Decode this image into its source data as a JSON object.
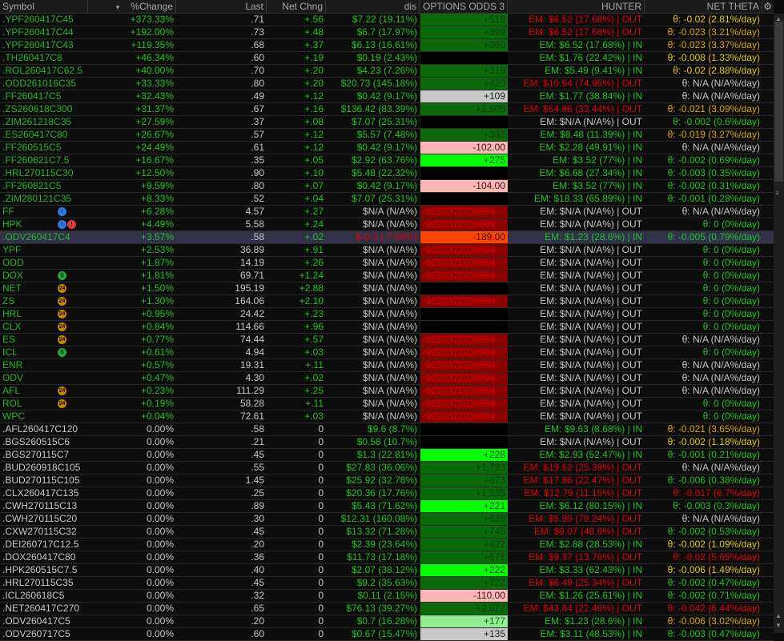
{
  "header": {
    "symbol": "Symbol",
    "sort_icon": "▾",
    "pct": "%Change",
    "last": "Last",
    "net": "Net Chng",
    "dis": "dis",
    "odds": "OPTIONS ODDS 3",
    "hunter": "HUNTER",
    "theta": "NET THETA"
  },
  "icons": {
    "b": {
      "glyph": "!",
      "bg": "#2a7be4"
    },
    "rd": {
      "glyph": "!",
      "bg": "#e03a3a"
    },
    "s": {
      "glyph": "S",
      "bg": "#1faa3a"
    },
    "e": {
      "glyph": "24",
      "bg": "#c8860a"
    }
  },
  "rows": [
    {
      "c": [
        ".YPF260417C45",
        "+373.33%",
        ".71",
        "+.56",
        "$7.22 (19.11%)",
        "+518",
        "EM: $6.52 (17.68%) | OUT",
        "θ: -0.02 (2.81%/day)"
      ],
      "s": "sg",
      "l": "w",
      "d": "g",
      "ob": "dg",
      "h": "r",
      "t": "y"
    },
    {
      "c": [
        ".YPF260417C44",
        "+192.00%",
        ".73",
        "+.48",
        "$6.7 (17.97%)",
        "+399",
        "EM: $6.52 (17.68%) | OUT",
        "θ: -0.023 (3.21%/day)"
      ],
      "s": "sg",
      "l": "w",
      "d": "g",
      "ob": "dg",
      "h": "r",
      "t": "o"
    },
    {
      "c": [
        ".YPF260417C43",
        "+119.35%",
        ".68",
        "+.37",
        "$6.13 (16.61%)",
        "+360",
        "EM: $6.52 (17.68%) | IN",
        "θ: -0.023 (3.37%/day)"
      ],
      "s": "sg",
      "l": "w",
      "d": "g",
      "ob": "dg",
      "h": "g",
      "t": "o"
    },
    {
      "c": [
        ".TH260417C8",
        "+46.34%",
        ".60",
        "+.19",
        "$0.19 (2.43%)",
        "",
        "EM: $1.76 (22.42%) | IN",
        "θ: -0.008 (1.33%/day)"
      ],
      "s": "sg",
      "l": "w",
      "d": "g",
      "ob": "bk",
      "h": "g",
      "t": "y"
    },
    {
      "c": [
        ".ROL260417C62.5",
        "+40.00%",
        ".70",
        "+.20",
        "$4.23 (7.26%)",
        "+318",
        "EM: $5.49 (9.41%) | IN",
        "θ: -0.02 (2.88%/day)"
      ],
      "s": "sg",
      "l": "w",
      "d": "g",
      "ob": "dg",
      "h": "g",
      "t": "y"
    },
    {
      "c": [
        ".ODD261016C35",
        "+33.33%",
        ".80",
        "+.20",
        "$20.73 (145.18%)",
        "+420",
        "EM: $10.64 (74.95%) | OUT",
        "θ: N/A (N/A%/day)"
      ],
      "s": "sg",
      "l": "w",
      "d": "g",
      "ob": "dg",
      "h": "r",
      "t": "w"
    },
    {
      "c": [
        ".FF260417C5",
        "+32.43%",
        ".49",
        "+.12",
        "$0.42 (9.17%)",
        "+109",
        "EM: $1.77 (38.84%) | IN",
        "θ: N/A (N/A%/day)"
      ],
      "s": "sg",
      "l": "w",
      "d": "g",
      "ob": "gray",
      "h": "g",
      "t": "w"
    },
    {
      "c": [
        ".ZS260618C300",
        "+31.37%",
        ".67",
        "+.16",
        "$136.42 (83.39%)",
        "+2,505",
        "EM: $54.86 (33.44%) | OUT",
        "θ: -0.021 (3.09%/day)"
      ],
      "s": "sg",
      "l": "w",
      "d": "g",
      "ob": "dg",
      "h": "r",
      "t": "o"
    },
    {
      "c": [
        ".ZIM261218C35",
        "+27.59%",
        ".37",
        "+.08",
        "$7.07 (25.31%)",
        "",
        "EM: $N/A (N/A%) | OUT",
        "θ: -0.002 (0.6%/day)"
      ],
      "s": "sg",
      "l": "w",
      "d": "g",
      "ob": "bk",
      "h": "w",
      "t": "g"
    },
    {
      "c": [
        ".ES260417C80",
        "+26.67%",
        ".57",
        "+.12",
        "$5.57 (7.48%)",
        "+382",
        "EM: $8.48 (11.39%) | IN",
        "θ: -0.019 (3.27%/day)"
      ],
      "s": "sg",
      "l": "w",
      "d": "g",
      "ob": "dg",
      "h": "g",
      "t": "o"
    },
    {
      "c": [
        ".FF260515C5",
        "+24.49%",
        ".61",
        "+.12",
        "$0.42 (9.17%)",
        "-102.00",
        "EM: $2.28 (49.91%) | IN",
        "θ: N/A (N/A%/day)"
      ],
      "s": "sg",
      "l": "w",
      "d": "g",
      "ob": "pink",
      "h": "g",
      "t": "w"
    },
    {
      "c": [
        ".FF260821C7.5",
        "+16.67%",
        ".35",
        "+.05",
        "$2.92 (63.76%)",
        "+275",
        "EM: $3.52 (77%) | IN",
        "θ: -0.002 (0.69%/day)"
      ],
      "s": "sg",
      "l": "w",
      "d": "g",
      "ob": "lime",
      "h": "g",
      "t": "g"
    },
    {
      "c": [
        ".HRL270115C30",
        "+12.50%",
        ".90",
        "+.10",
        "$5.48 (22.32%)",
        "",
        "EM: $6.68 (27.34%) | IN",
        "θ: -0.003 (0.35%/day)"
      ],
      "s": "sg",
      "l": "w",
      "d": "g",
      "ob": "bk",
      "h": "g",
      "t": "g"
    },
    {
      "c": [
        ".FF260821C5",
        "+9.59%",
        ".80",
        "+.07",
        "$0.42 (9.17%)",
        "-104.00",
        "EM: $3.52 (77%) | IN",
        "θ: -0.002 (0.31%/day)"
      ],
      "s": "sg",
      "l": "w",
      "d": "g",
      "ob": "pink",
      "h": "g",
      "t": "g"
    },
    {
      "c": [
        ".ZIM280121C35",
        "+8.33%",
        ".52",
        "+.04",
        "$7.07 (25.31%)",
        "",
        "EM: $18.33 (65.89%) | IN",
        "θ: -0.001 (0.28%/day)"
      ],
      "s": "sg",
      "l": "w",
      "d": "g",
      "ob": "bk",
      "h": "g",
      "t": "g"
    },
    {
      "c": [
        "FF",
        "+6.28%",
        "4.57",
        "+.27",
        "$N/A (N/A%)",
        "-92233720368547...",
        "EM: $N/A (N/A%) | OUT",
        "θ: N/A (N/A%/day)"
      ],
      "s": "sg",
      "l": "w",
      "d": "w",
      "ob": "dr",
      "h": "w",
      "t": "w",
      "i": [
        "b"
      ]
    },
    {
      "c": [
        "HPK",
        "+4.49%",
        "5.58",
        "+.24",
        "$N/A (N/A%)",
        "-92233720368547...",
        "EM: $N/A (N/A%) | OUT",
        "θ: 0 (0%/day)"
      ],
      "s": "sg",
      "l": "w",
      "d": "w",
      "ob": "dr",
      "h": "w",
      "t": "g",
      "i": [
        "b",
        "rd"
      ]
    },
    {
      "c": [
        ".ODV260417C4",
        "+3.57%",
        ".58",
        "+.02",
        "$-0.3 (-7.08%)",
        "-189.00",
        "EM: $1.23 (28.6%) | IN",
        "θ: -0.005 (0.79%/day)"
      ],
      "s": "sg",
      "l": "w",
      "d": "r",
      "ob": "or",
      "h": "g",
      "t": "g",
      "sel": true
    },
    {
      "c": [
        "YPF",
        "+2.53%",
        "36.89",
        "+.91",
        "$N/A (N/A%)",
        "-92233720368547...",
        "EM: $N/A (N/A%) | OUT",
        "θ: 0 (0%/day)"
      ],
      "s": "sg",
      "l": "w",
      "d": "w",
      "ob": "dr",
      "h": "w",
      "t": "g"
    },
    {
      "c": [
        "ODD",
        "+1.87%",
        "14.19",
        "+.26",
        "$N/A (N/A%)",
        "-92233720368547...",
        "EM: $N/A (N/A%) | OUT",
        "θ: 0 (0%/day)"
      ],
      "s": "sg",
      "l": "w",
      "d": "w",
      "ob": "dr",
      "h": "w",
      "t": "g"
    },
    {
      "c": [
        "DOX",
        "+1.81%",
        "69.71",
        "+1.24",
        "$N/A (N/A%)",
        "-92233720368547...",
        "EM: $N/A (N/A%) | OUT",
        "θ: 0 (0%/day)"
      ],
      "s": "sg",
      "l": "w",
      "d": "w",
      "ob": "dr",
      "h": "w",
      "t": "g",
      "i": [
        "s"
      ]
    },
    {
      "c": [
        "NET",
        "+1.50%",
        "195.19",
        "+2.88",
        "$N/A (N/A%)",
        "",
        "EM: $N/A (N/A%) | OUT",
        "θ: 0 (0%/day)"
      ],
      "s": "sg",
      "l": "w",
      "d": "w",
      "ob": "bk",
      "h": "w",
      "t": "g",
      "i": [
        "e"
      ]
    },
    {
      "c": [
        "ZS",
        "+1.30%",
        "164.06",
        "+2.10",
        "$N/A (N/A%)",
        "-92233720368547...",
        "EM: $N/A (N/A%) | OUT",
        "θ: 0 (0%/day)"
      ],
      "s": "sg",
      "l": "w",
      "d": "w",
      "ob": "dr",
      "h": "w",
      "t": "g",
      "i": [
        "e"
      ]
    },
    {
      "c": [
        "HRL",
        "+0.95%",
        "24.42",
        "+.23",
        "$N/A (N/A%)",
        "",
        "EM: $N/A (N/A%) | OUT",
        "θ: 0 (0%/day)"
      ],
      "s": "sg",
      "l": "w",
      "d": "w",
      "ob": "bk",
      "h": "w",
      "t": "g",
      "i": [
        "e"
      ]
    },
    {
      "c": [
        "CLX",
        "+0.84%",
        "114.66",
        "+.96",
        "$N/A (N/A%)",
        "",
        "EM: $N/A (N/A%) | OUT",
        "θ: 0 (0%/day)"
      ],
      "s": "sg",
      "l": "w",
      "d": "w",
      "ob": "bk",
      "h": "w",
      "t": "g",
      "i": [
        "e"
      ]
    },
    {
      "c": [
        "ES",
        "+0.77%",
        "74.44",
        "+.57",
        "$N/A (N/A%)",
        "-92233720368547...",
        "EM: $N/A (N/A%) | OUT",
        "θ: N/A (N/A%/day)"
      ],
      "s": "sg",
      "l": "w",
      "d": "w",
      "ob": "dr",
      "h": "w",
      "t": "w",
      "i": [
        "e"
      ]
    },
    {
      "c": [
        "ICL",
        "+0.61%",
        "4.94",
        "+.03",
        "$N/A (N/A%)",
        "-92233720368547...",
        "EM: $N/A (N/A%) | OUT",
        "θ: 0 (0%/day)"
      ],
      "s": "sg",
      "l": "w",
      "d": "w",
      "ob": "dr",
      "h": "w",
      "t": "g",
      "i": [
        "s"
      ]
    },
    {
      "c": [
        "ENR",
        "+0.57%",
        "19.31",
        "+.11",
        "$N/A (N/A%)",
        "-92233720368547...",
        "EM: $N/A (N/A%) | OUT",
        "θ: N/A (N/A%/day)"
      ],
      "s": "sg",
      "l": "w",
      "d": "w",
      "ob": "dr",
      "h": "w",
      "t": "w"
    },
    {
      "c": [
        "ODV",
        "+0.47%",
        "4.30",
        "+.02",
        "$N/A (N/A%)",
        "-92233720368547...",
        "EM: $N/A (N/A%) | OUT",
        "θ: N/A (N/A%/day)"
      ],
      "s": "sg",
      "l": "w",
      "d": "w",
      "ob": "dr",
      "h": "w",
      "t": "w"
    },
    {
      "c": [
        "AFL",
        "+0.23%",
        "111.29",
        "+.25",
        "$N/A (N/A%)",
        "-92233720368547...",
        "EM: $N/A (N/A%) | OUT",
        "θ: N/A (N/A%/day)"
      ],
      "s": "sg",
      "l": "w",
      "d": "w",
      "ob": "dr",
      "h": "w",
      "t": "w",
      "i": [
        "e"
      ]
    },
    {
      "c": [
        "ROL",
        "+0.19%",
        "58.28",
        "+.11",
        "$N/A (N/A%)",
        "-92233720368547...",
        "EM: $N/A (N/A%) | OUT",
        "θ: 0 (0%/day)"
      ],
      "s": "sg",
      "l": "w",
      "d": "w",
      "ob": "dr",
      "h": "w",
      "t": "g",
      "i": [
        "e"
      ]
    },
    {
      "c": [
        "WPC",
        "+0.04%",
        "72.61",
        "+.03",
        "$N/A (N/A%)",
        "-92233720368547...",
        "EM: $N/A (N/A%) | OUT",
        "θ: 0 (0%/day)"
      ],
      "s": "sg",
      "l": "w",
      "d": "w",
      "ob": "dr",
      "h": "w",
      "t": "g"
    },
    {
      "c": [
        ".AFL260417C120",
        "0.00%",
        ".58",
        "0",
        "$9.6 (8.7%)",
        "",
        "EM: $9.63 (8.68%) | IN",
        "θ: -0.021 (3.65%/day)"
      ],
      "s": "w",
      "l": "w",
      "d": "g",
      "ob": "bk",
      "h": "g",
      "t": "o"
    },
    {
      "c": [
        ".BGS260515C6",
        "0.00%",
        ".21",
        "0",
        "$0.58 (10.7%)",
        "",
        "EM: $N/A (N/A%) | OUT",
        "θ: -0.002 (1.18%/day)"
      ],
      "s": "w",
      "l": "w",
      "d": "g",
      "ob": "bk",
      "h": "w",
      "t": "y"
    },
    {
      "c": [
        ".BGS270115C7",
        "0.00%",
        ".45",
        "0",
        "$1.3 (22.81%)",
        "+228",
        "EM: $2.93 (52.47%) | IN",
        "θ: -0.001 (0.21%/day)"
      ],
      "s": "w",
      "l": "w",
      "d": "g",
      "ob": "lime",
      "h": "g",
      "t": "g"
    },
    {
      "c": [
        ".BUD260918C105",
        "0.00%",
        ".55",
        "0",
        "$27.83 (36.06%)",
        "+1,793",
        "EM: $19.62 (25.39%) | OUT",
        "θ: N/A (N/A%/day)"
      ],
      "s": "w",
      "l": "w",
      "d": "g",
      "ob": "dg",
      "h": "r",
      "t": "w"
    },
    {
      "c": [
        ".BUD270115C105",
        "0.00%",
        "1.45",
        "0",
        "$25.92 (32.78%)",
        "+873",
        "EM: $17.86 (22.47%) | OUT",
        "θ: -0.006 (0.38%/day)"
      ],
      "s": "w",
      "l": "w",
      "d": "g",
      "ob": "dg",
      "h": "r",
      "t": "g"
    },
    {
      "c": [
        ".CLX260417C135",
        "0.00%",
        ".25",
        "0",
        "$20.36 (17.76%)",
        "+1,535",
        "EM: $12.79 (11.15%) | OUT",
        "θ: -0.017 (6.7%/day)"
      ],
      "s": "w",
      "l": "w",
      "d": "g",
      "ob": "dg",
      "h": "r",
      "t": "r"
    },
    {
      "c": [
        ".CWH270115C13",
        "0.00%",
        ".89",
        "0",
        "$5.43 (71.62%)",
        "+221",
        "EM: $6.12 (80.15%) | IN",
        "θ: -0.003 (0.3%/day)"
      ],
      "s": "w",
      "l": "w",
      "d": "g",
      "ob": "lime",
      "h": "g",
      "t": "g"
    },
    {
      "c": [
        ".CWH270115C20",
        "0.00%",
        ".30",
        "0",
        "$12.31 (160.08%)",
        "+639",
        "EM: $5.99 (78.24%) | OUT",
        "θ: N/A (N/A%/day)"
      ],
      "s": "w",
      "l": "w",
      "d": "g",
      "ob": "dg",
      "h": "r",
      "t": "w"
    },
    {
      "c": [
        ".CXW270115C32",
        "0.00%",
        ".45",
        "0",
        "$13.32 (71.28%)",
        "+745",
        "EM: $9.07 (48.6%) | OUT",
        "θ: -0.002 (0.53%/day)"
      ],
      "s": "w",
      "l": "w",
      "d": "g",
      "ob": "dg",
      "h": "r",
      "t": "g"
    },
    {
      "c": [
        ".DEI260717C12.5",
        "0.00%",
        ".20",
        "0",
        "$2.39 (23.64%)",
        "+422",
        "EM: $2.88 (28.53%) | IN",
        "θ: -0.002 (1.09%/day)"
      ],
      "s": "w",
      "l": "w",
      "d": "g",
      "ob": "dg",
      "h": "g",
      "t": "y"
    },
    {
      "c": [
        ".DOX260417C80",
        "0.00%",
        ".36",
        "0",
        "$11.73 (17.18%)",
        "+671",
        "EM: $9.37 (13.76%) | OUT",
        "θ: -0.02 (5.65%/day)"
      ],
      "s": "w",
      "l": "w",
      "d": "g",
      "ob": "dg",
      "h": "r",
      "t": "r"
    },
    {
      "c": [
        ".HPK260515C7.5",
        "0.00%",
        ".40",
        "0",
        "$2.07 (38.12%)",
        "+222",
        "EM: $3.33 (62.43%) | IN",
        "θ: -0.006 (1.49%/day)"
      ],
      "s": "w",
      "l": "w",
      "d": "g",
      "ob": "lime",
      "h": "g",
      "t": "y"
    },
    {
      "c": [
        ".HRL270115C35",
        "0.00%",
        ".45",
        "0",
        "$9.2 (35.63%)",
        "+722",
        "EM: $6.49 (25.34%) | OUT",
        "θ: -0.002 (0.47%/day)"
      ],
      "s": "w",
      "l": "w",
      "d": "g",
      "ob": "dg",
      "h": "r",
      "t": "g"
    },
    {
      "c": [
        ".ICL260618C5",
        "0.00%",
        ".32",
        "0",
        "$0.11 (2.15%)",
        "-110.00",
        "EM: $1.26 (25.61%) | IN",
        "θ: -0.002 (0.71%/day)"
      ],
      "s": "w",
      "l": "w",
      "d": "g",
      "ob": "pink",
      "h": "g",
      "t": "g"
    },
    {
      "c": [
        ".NET260417C270",
        "0.00%",
        ".65",
        "0",
        "$76.13 (39.27%)",
        "+2,027",
        "EM: $43.84 (22.46%) | OUT",
        "θ: -0.042 (6.44%/day)"
      ],
      "s": "w",
      "l": "w",
      "d": "g",
      "ob": "dg",
      "h": "r",
      "t": "r"
    },
    {
      "c": [
        ".ODV260417C5",
        "0.00%",
        ".20",
        "0",
        "$0.7 (16.28%)",
        "+177",
        "EM: $1.23 (28.6%) | IN",
        "θ: -0.006 (3.02%/day)"
      ],
      "s": "w",
      "l": "w",
      "d": "g",
      "ob": "lg",
      "h": "g",
      "t": "o"
    },
    {
      "c": [
        ".ODV260717C5",
        "0.00%",
        ".60",
        "0",
        "$0.67 (15.47%)",
        "+135",
        "EM: $3.11 (48.53%) | IN",
        "θ: -0.003 (0.47%/day)"
      ],
      "s": "w",
      "l": "w",
      "d": "g",
      "ob": "gray",
      "h": "g",
      "t": "g"
    }
  ]
}
